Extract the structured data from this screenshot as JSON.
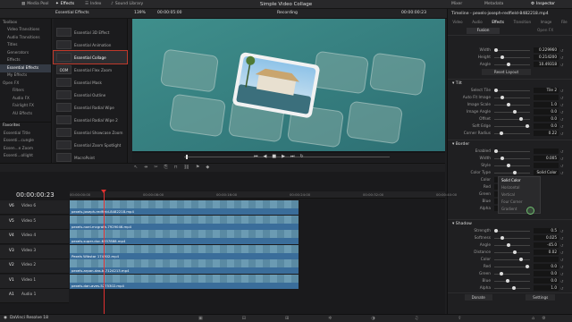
{
  "topbar": {
    "media_pool": "Media Pool",
    "effects": "Effects",
    "index": "Index",
    "sound_library": "Sound Library",
    "project_title": "Simple Video Collage",
    "mixer": "Mixer",
    "metadata": "Metadata",
    "inspector": "Inspector"
  },
  "viewer_header": {
    "zoom": "139%",
    "timecode_left": "00:00:05:00",
    "recording": "Recording",
    "timecode_right": "00:00:00:23"
  },
  "left_panel": {
    "items": [
      "Toolbox",
      "Video Transitions",
      "Audio Transitions",
      "Titles",
      "Generators",
      "Effects",
      "Essential Effects",
      "My Effects",
      "Open FX",
      "Filters",
      "Audio FX",
      "Fairlight FX",
      "AU Effects"
    ],
    "favorites_label": "Favorites",
    "favorites": [
      "Essential Title",
      "Essenti...cungle",
      "Essen...e Zoom",
      "Essenti...ollight"
    ]
  },
  "effects_list": {
    "header": "Essential Effects",
    "items": [
      {
        "thumb": "",
        "label": "Essential 3D Effect"
      },
      {
        "thumb": "",
        "label": "Essential Animation"
      },
      {
        "thumb": "",
        "label": "Essential Collage"
      },
      {
        "thumb": "OOM",
        "label": "Essential Flex Zoom"
      },
      {
        "thumb": "",
        "label": "Essential Mask"
      },
      {
        "thumb": "",
        "label": "Essential Outline"
      },
      {
        "thumb": "",
        "label": "Essential Radial Wipe"
      },
      {
        "thumb": "",
        "label": "Essential Radial Wipe 2"
      },
      {
        "thumb": "",
        "label": "Essential Showcase Zoom"
      },
      {
        "thumb": "",
        "label": "Essential Zoom Spotlight"
      },
      {
        "thumb": "",
        "label": "MacroPoint"
      }
    ]
  },
  "inspector": {
    "clip_name": "Timeline - pexels-joseph-redfield-8482218.mp4",
    "tabs": [
      "Video",
      "Audio",
      "Effects",
      "Transition",
      "Image",
      "File"
    ],
    "subtabs": [
      "Fusion",
      "Open FX"
    ],
    "transform": [
      {
        "label": "Width",
        "value": "0.229960"
      },
      {
        "label": "Height",
        "value": "0.214200"
      },
      {
        "label": "Angle",
        "value": "10.49318"
      }
    ],
    "reset_layout": "Reset Layout",
    "tilt_section": "Tilt",
    "tilt": [
      {
        "label": "Select Tile",
        "value": "Tile 2"
      },
      {
        "label": "Auto Fit Image",
        "value": ""
      },
      {
        "label": "Image Scale",
        "value": "1.0"
      },
      {
        "label": "Image Angle",
        "value": "0.0"
      },
      {
        "label": "Offset",
        "value": "0.0"
      },
      {
        "label": "Soft Edge",
        "value": "0.0"
      },
      {
        "label": "Corner Radius",
        "value": "0.22"
      }
    ],
    "border_section": "Border",
    "border": [
      {
        "label": "Enabled",
        "value": ""
      },
      {
        "label": "Width",
        "value": "0.005"
      },
      {
        "label": "Style",
        "value": ""
      },
      {
        "label": "Color Type",
        "value": "Solid Color"
      }
    ],
    "color_type_options": [
      "Solid Color",
      "Horizontal",
      "Vertical",
      "Four Corner",
      "Gradient"
    ],
    "border_colors": [
      {
        "label": "Color",
        "value": ""
      },
      {
        "label": "Red",
        "value": ""
      },
      {
        "label": "Green",
        "value": ""
      },
      {
        "label": "Blue",
        "value": ""
      },
      {
        "label": "Alpha",
        "value": ""
      }
    ],
    "shadow_section": "Shadow",
    "shadow": [
      {
        "label": "Strength",
        "value": "0.5"
      },
      {
        "label": "Softness",
        "value": "0.025"
      },
      {
        "label": "Angle",
        "value": "-45.0"
      },
      {
        "label": "Distance",
        "value": "0.02"
      },
      {
        "label": "Color",
        "value": ""
      },
      {
        "label": "Red",
        "value": "0.0"
      },
      {
        "label": "Green",
        "value": "0.0"
      },
      {
        "label": "Blue",
        "value": "0.0"
      },
      {
        "label": "Alpha",
        "value": "1.0"
      }
    ],
    "footer": {
      "donate": "Donate",
      "settings": "Settings"
    }
  },
  "timeline": {
    "timecode": "00:00:00:23",
    "ruler": [
      "00:00:00:00",
      "00:00:08:00",
      "00:00:16:00",
      "00:00:24:00",
      "00:00:32:00",
      "00:00:40:00"
    ],
    "tracks": [
      {
        "id": "V6",
        "name": "Video 6",
        "clip": "pexels-joseph-redfield-8482218.mp4"
      },
      {
        "id": "V5",
        "name": "Video 5",
        "clip": "pexels-noel-mcgrath-7929046.mp4"
      },
      {
        "id": "V4",
        "name": "Video 4",
        "clip": "pexels-super-duc-6357888.mp4"
      },
      {
        "id": "V3",
        "name": "Video 3",
        "clip": "Pexels Wibstar 174302.mp4"
      },
      {
        "id": "V2",
        "name": "Video 2",
        "clip": "pexels-arpan-das-b-7124213.mp4"
      },
      {
        "id": "V1",
        "name": "Video 1",
        "clip": "pexels-dan-aves-5275302.mp4"
      },
      {
        "id": "A1",
        "name": "Audio 1",
        "clip": ""
      }
    ]
  },
  "statusbar": {
    "app": "DaVinci Resolve 18"
  },
  "colors": {
    "accent": "#c0392b",
    "clip": "#3a6d9a",
    "playhead": "#e03030"
  }
}
